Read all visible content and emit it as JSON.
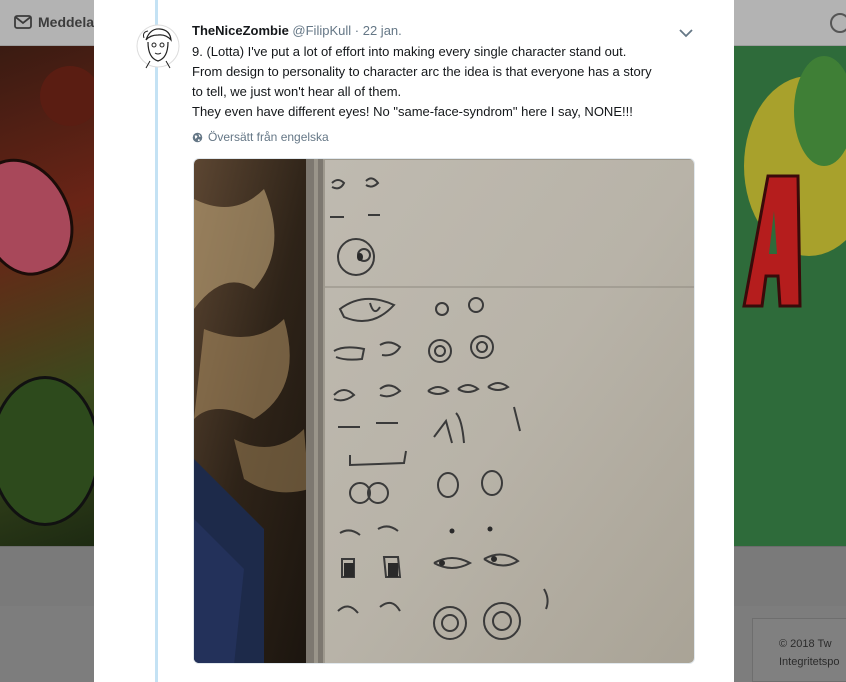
{
  "background": {
    "nav_messages_label": "Meddelanden",
    "footer_copyright": "© 2018 Tw",
    "footer_link": "Integritetspo"
  },
  "tweet": {
    "display_name": "TheNiceZombie",
    "handle": "@FilipKull",
    "separator": "·",
    "date": "22 jan.",
    "text_lines": [
      "9. (Lotta) I've put a lot of effort into making every single character stand out.",
      "From design to personality to character arc the idea is that everyone has a story",
      "to tell, we just won't hear all of them.",
      "They even have different eyes! No \"same-face-syndrom\" here I say, NONE!!!"
    ],
    "translate_label": "Översätt från engelska",
    "media_description_icons": [
      "eye-sketches-photo"
    ]
  },
  "colors": {
    "thread_line": "#c4e2f4",
    "name_text": "#14171a",
    "muted_text": "#657786",
    "overlay_bg": "#7d7d7d"
  },
  "icons": {
    "messages": "envelope-icon",
    "search": "search-icon",
    "caret": "chevron-down-icon",
    "translate": "globe-icon"
  }
}
